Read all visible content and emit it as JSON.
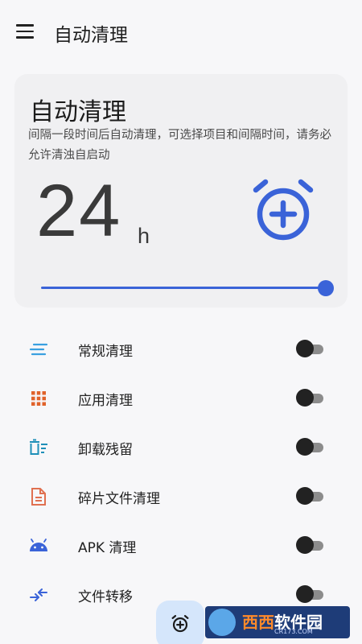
{
  "appbar": {
    "menu_icon": "menu-icon",
    "title": "自动清理"
  },
  "card": {
    "title": "自动清理",
    "description": "间隔一段时间后自动清理，可选择项目和间隔时间，请务必允许清浊自启动",
    "interval_value": "24",
    "interval_unit": "h",
    "add_icon": "alarm-add-icon",
    "slider_level": 1.0,
    "accent_color": "#3a63d8"
  },
  "items": [
    {
      "label": "常规清理",
      "icon": "lines-icon",
      "icon_color": "#3aa0e0",
      "enabled": false
    },
    {
      "label": "应用清理",
      "icon": "grid-icon",
      "icon_color": "#e0622a",
      "enabled": false
    },
    {
      "label": "卸载残留",
      "icon": "trash-list-icon",
      "icon_color": "#1e8fb8",
      "enabled": false
    },
    {
      "label": "碎片文件清理",
      "icon": "file-icon",
      "icon_color": "#e07050",
      "enabled": false
    },
    {
      "label": "APK 清理",
      "icon": "android-icon",
      "icon_color": "#3a63d8",
      "enabled": false
    },
    {
      "label": "文件转移",
      "icon": "transfer-icon",
      "icon_color": "#3a63d8",
      "enabled": false
    }
  ],
  "fab": {
    "icon": "alarm-add-icon"
  },
  "watermark": {
    "brand": "西西",
    "name": "软件园",
    "site": "CR173.COM"
  }
}
